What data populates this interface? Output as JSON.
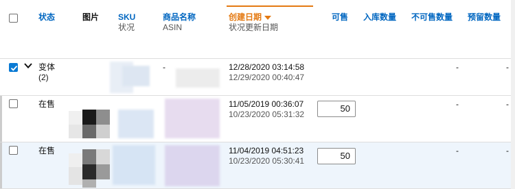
{
  "header": {
    "status": "状态",
    "image": "图片",
    "sku": "SKU",
    "sku_sub": "状况",
    "product_name": "商品名称",
    "product_sub": "ASIN",
    "created": "创建日期",
    "created_sub": "状况更新日期",
    "available": "可售",
    "inbound": "入库数量",
    "unfulfillable": "不可售数量",
    "reserved": "预留数量"
  },
  "rows": [
    {
      "status": "变体",
      "status_sub": "(2)",
      "checked": true,
      "product": "-",
      "created": "12/28/2020 03:14:58",
      "updated": "12/29/2020 00:40:47",
      "unfulfillable": "-",
      "reserved": "-"
    },
    {
      "status": "在售",
      "checked": false,
      "created": "11/05/2019 00:36:07",
      "updated": "10/23/2020 05:31:32",
      "qty": "50",
      "unfulfillable": "-",
      "reserved": "-"
    },
    {
      "status": "在售",
      "checked": false,
      "created": "11/04/2019 04:51:23",
      "updated": "10/23/2020 05:30:41",
      "qty": "50",
      "unfulfillable": "-",
      "reserved": "-"
    }
  ],
  "colors": {
    "link": "#0066c0",
    "sorted": "#e47911",
    "checkbox_checked": "#0a7ad4",
    "row_highlight": "#eef5fc"
  }
}
